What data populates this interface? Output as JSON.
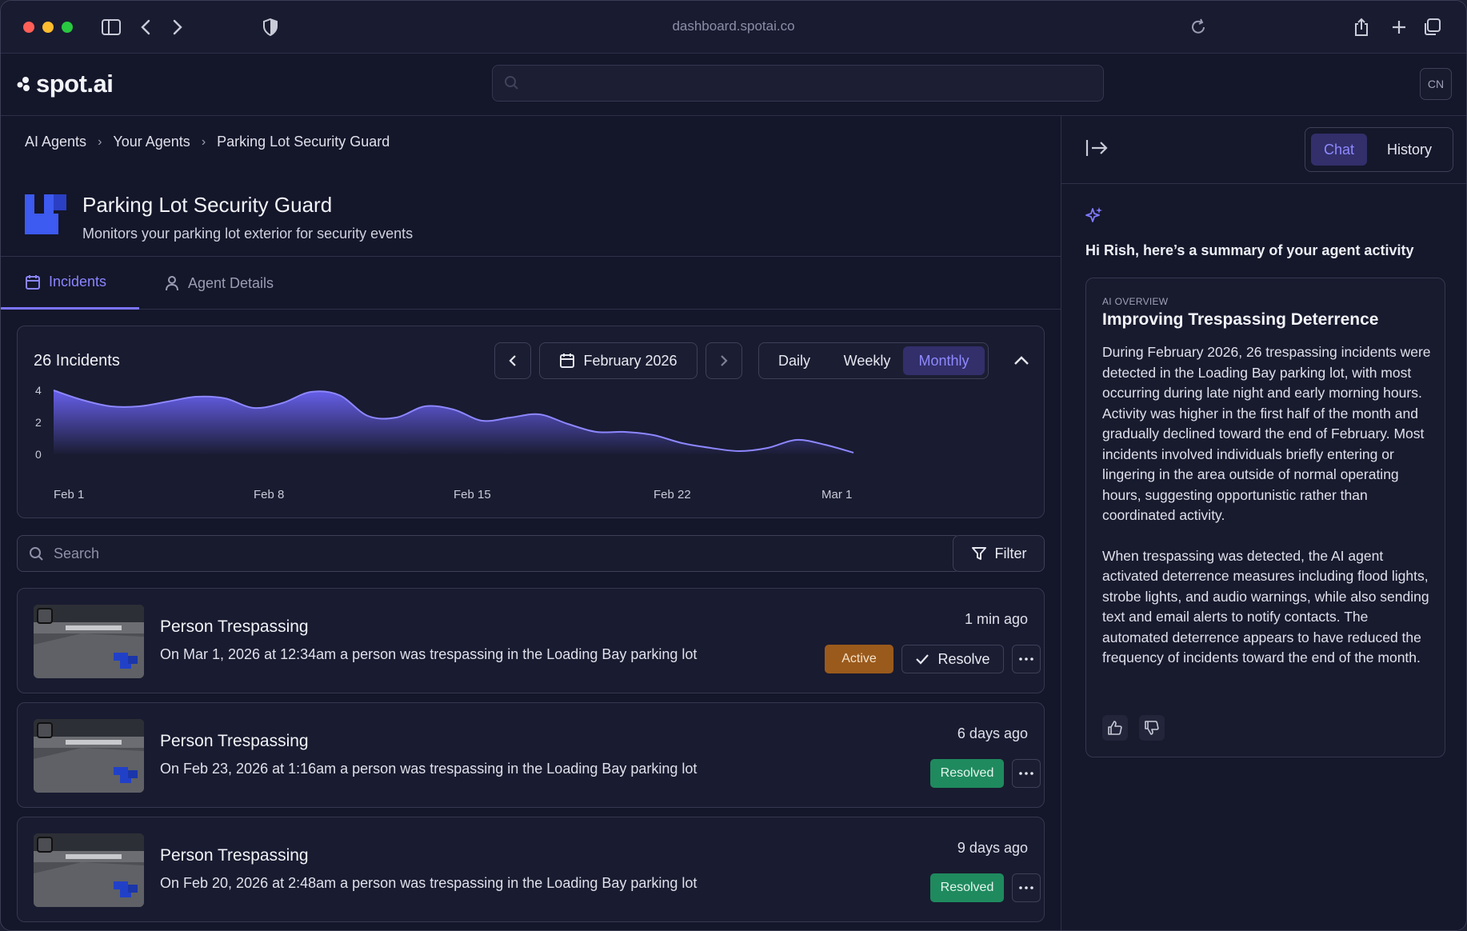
{
  "browser": {
    "url": "dashboard.spotai.co"
  },
  "app": {
    "logo_text": "spot.ai",
    "user_initials": "CN"
  },
  "breadcrumb": [
    "AI Agents",
    "Your Agents",
    "Parking Lot Security Guard"
  ],
  "agent": {
    "title": "Parking Lot Security Guard",
    "subtitle": "Monitors your parking lot exterior for security events"
  },
  "tabs": [
    {
      "label": "Incidents",
      "active": true
    },
    {
      "label": "Agent Details",
      "active": false
    }
  ],
  "chart_card": {
    "title": "26 Incidents",
    "month_label": "February 2026",
    "ranges": [
      "Daily",
      "Weekly",
      "Monthly"
    ],
    "active_range": "Monthly"
  },
  "chart_data": {
    "type": "area",
    "x_ticks": [
      "Feb 1",
      "Feb 8",
      "Feb 15",
      "Feb 22",
      "Mar 1"
    ],
    "y_ticks": [
      "4",
      "2",
      "0"
    ],
    "ylim": [
      0,
      4.5
    ],
    "x": [
      1,
      2,
      3,
      4,
      5,
      6,
      7,
      8,
      9,
      10,
      11,
      12,
      13,
      14,
      15,
      16,
      17,
      18,
      19,
      20,
      21,
      22,
      23,
      24,
      25,
      26,
      27,
      28,
      29
    ],
    "values": [
      4.0,
      3.4,
      3.0,
      3.0,
      3.3,
      3.6,
      3.5,
      2.9,
      3.2,
      3.9,
      3.7,
      2.4,
      2.3,
      3.0,
      2.8,
      2.1,
      2.3,
      2.5,
      1.9,
      1.4,
      1.4,
      1.2,
      0.7,
      0.4,
      0.2,
      0.4,
      0.9,
      0.6,
      0.1
    ],
    "color": "#6b63f5"
  },
  "search": {
    "placeholder": "Search"
  },
  "filter": {
    "label": "Filter"
  },
  "incidents": [
    {
      "title": "Person Trespassing",
      "description": "On Mar 1, 2026 at 12:34am a person was trespassing in the Loading Bay parking lot",
      "time": "1 min ago",
      "status": "Active",
      "resolve_label": "Resolve"
    },
    {
      "title": "Person Trespassing",
      "description": "On Feb 23, 2026 at 1:16am a person was trespassing in the Loading Bay parking lot",
      "time": "6 days ago",
      "status": "Resolved"
    },
    {
      "title": "Person Trespassing",
      "description": "On Feb 20, 2026 at 2:48am a person was trespassing in the Loading Bay parking lot",
      "time": "9 days ago",
      "status": "Resolved"
    }
  ],
  "side": {
    "tabs": [
      "Chat",
      "History"
    ],
    "active_tab": "Chat",
    "greeting": "Hi Rish, here’s a summary of your agent activity",
    "overview_label": "AI OVERVIEW",
    "overview_title": "Improving Trespassing Deterrence",
    "paragraphs": [
      "During February 2026, 26 trespassing incidents were detected in the Loading Bay parking lot, with most occurring during late night and early morning hours. Activity was higher in the first half of the month and gradually declined toward the end of February. Most incidents involved individuals briefly entering or lingering in the area outside of normal operating hours, suggesting opportunistic rather than coordinated activity.",
      "When trespassing was detected, the AI agent activated deterrence measures including flood lights, strobe lights, and audio warnings, while also sending text and email alerts to notify contacts. The automated deterrence appears to have reduced the frequency of incidents toward the end of the month."
    ]
  }
}
